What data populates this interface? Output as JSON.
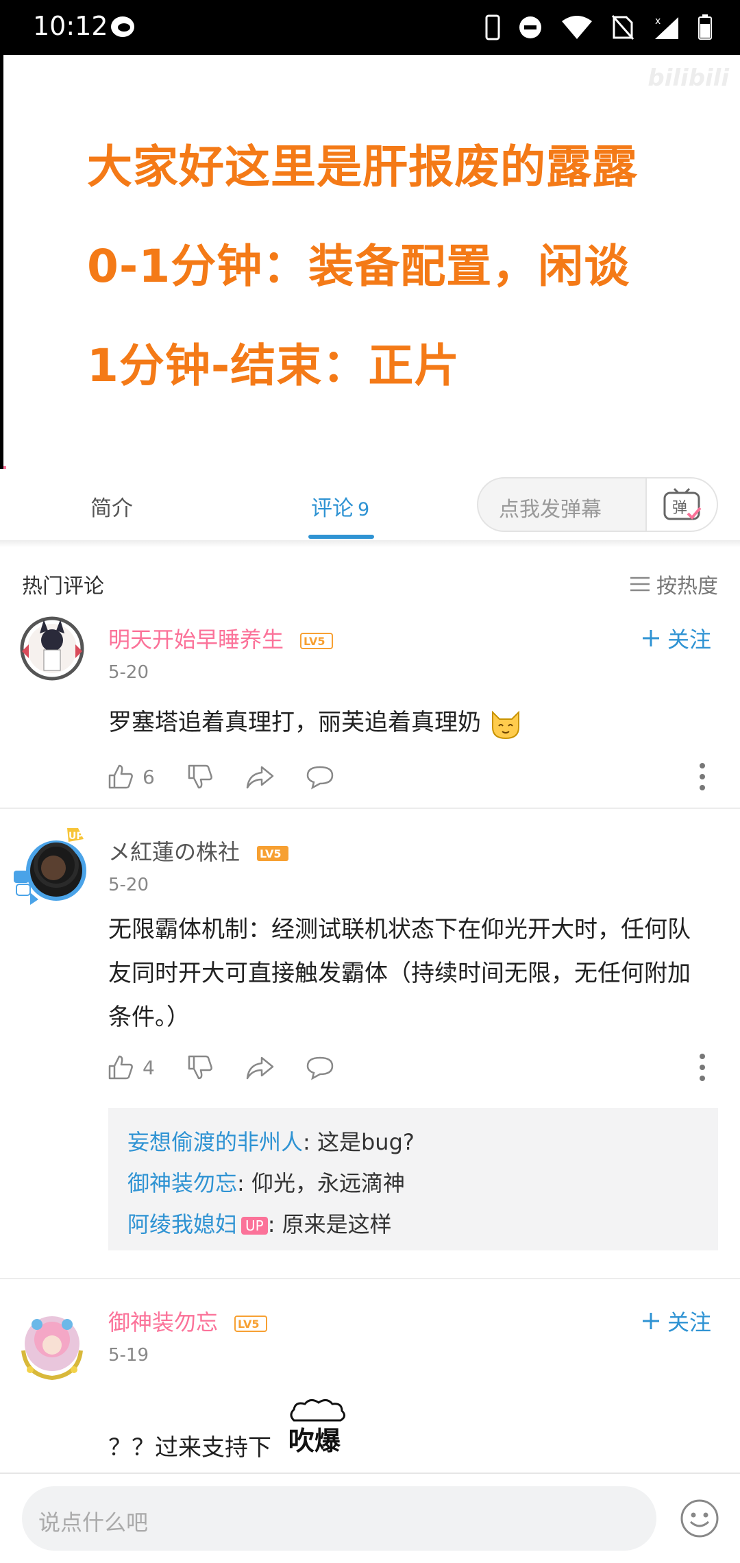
{
  "status_bar": {
    "time": "10:12"
  },
  "video": {
    "lines": [
      "大家好这里是肝报废的露露",
      "0-1分钟：装备配置，闲谈",
      "1分钟-结束：正片"
    ],
    "watermark": "bilibili"
  },
  "tabs": {
    "intro": "简介",
    "comments": "评论",
    "comments_count": "9"
  },
  "danmaku": {
    "placeholder": "点我发弹幕",
    "button": "弹"
  },
  "comments_header": {
    "title": "热门评论",
    "sort": "按热度"
  },
  "comments": [
    {
      "username": "明天开始早睡养生",
      "level": "LV5",
      "date": "5-20",
      "follow": "关注",
      "content": "罗塞塔追着真理打，丽芙追着真理奶",
      "likes": "6"
    },
    {
      "username": "メ紅蓮の株社",
      "level": "LV5",
      "date": "5-20",
      "content": "无限霸体机制：经测试联机状态下在仰光开大时，任何队友同时开大可直接触发霸体（持续时间无限，无任何附加条件。）",
      "likes": "4",
      "replies": [
        {
          "user": "妄想偷渡的非州人",
          "text": ": 这是bug?"
        },
        {
          "user": "御神装勿忘",
          "text": ": 仰光，永远滴神"
        },
        {
          "user": "阿绫我媳妇",
          "badge": "UP",
          "text": ": 原来是这样"
        }
      ]
    },
    {
      "username": "御神装勿忘",
      "level": "LV5",
      "date": "5-19",
      "follow": "关注",
      "content": "？？过来支持下",
      "sticker_text": "吹爆"
    }
  ],
  "bottom": {
    "placeholder": "说点什么吧"
  }
}
